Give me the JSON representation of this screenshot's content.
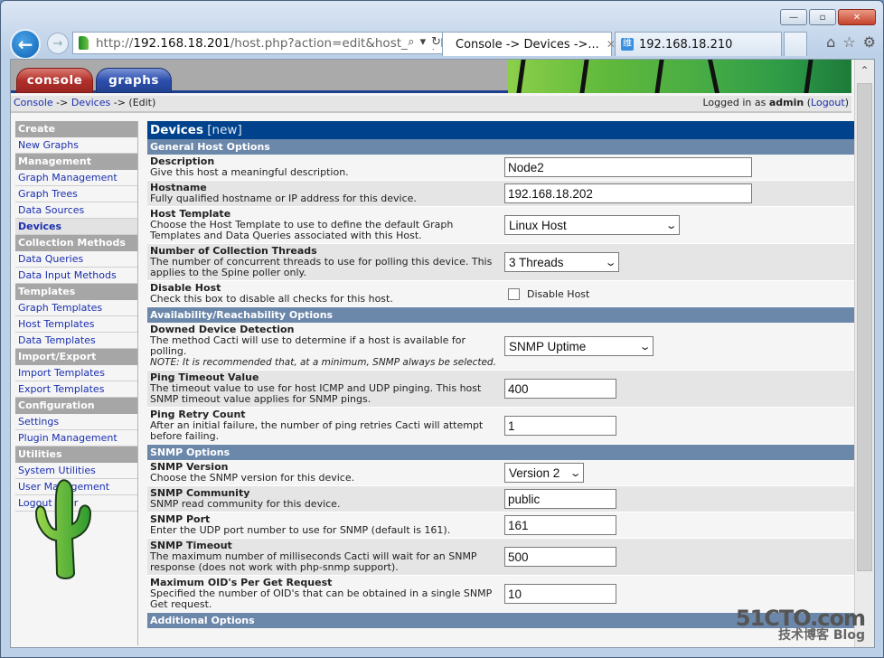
{
  "browser": {
    "address_url_prefix": "http://",
    "address_host": "192.168.18.201",
    "address_path": "/host.php?action=edit&host_templ",
    "tabs": [
      {
        "title": "Console -> Devices ->...",
        "active": true
      },
      {
        "title": "192.168.18.210",
        "active": false
      }
    ],
    "window_controls": {
      "minimize": "—",
      "maximize": "▫",
      "close": "✕"
    }
  },
  "header": {
    "tabs": [
      {
        "label": "console"
      },
      {
        "label": "graphs"
      }
    ]
  },
  "breadcrumb": {
    "items": [
      "Console",
      "Devices",
      "(Edit)"
    ],
    "separator": "->",
    "login_prefix": "Logged in as",
    "user": "admin",
    "logout": "Logout"
  },
  "sidebar": {
    "items": [
      {
        "type": "head",
        "label": "Create"
      },
      {
        "type": "link",
        "label": "New Graphs"
      },
      {
        "type": "head",
        "label": "Management"
      },
      {
        "type": "link",
        "label": "Graph Management"
      },
      {
        "type": "link",
        "label": "Graph Trees"
      },
      {
        "type": "link",
        "label": "Data Sources"
      },
      {
        "type": "active",
        "label": "Devices"
      },
      {
        "type": "head",
        "label": "Collection Methods"
      },
      {
        "type": "link",
        "label": "Data Queries"
      },
      {
        "type": "link",
        "label": "Data Input Methods"
      },
      {
        "type": "head",
        "label": "Templates"
      },
      {
        "type": "link",
        "label": "Graph Templates"
      },
      {
        "type": "link",
        "label": "Host Templates"
      },
      {
        "type": "link",
        "label": "Data Templates"
      },
      {
        "type": "head",
        "label": "Import/Export"
      },
      {
        "type": "link",
        "label": "Import Templates"
      },
      {
        "type": "link",
        "label": "Export Templates"
      },
      {
        "type": "head",
        "label": "Configuration"
      },
      {
        "type": "link",
        "label": "Settings"
      },
      {
        "type": "link",
        "label": "Plugin Management"
      },
      {
        "type": "head",
        "label": "Utilities"
      },
      {
        "type": "link",
        "label": "System Utilities"
      },
      {
        "type": "link",
        "label": "User Management"
      },
      {
        "type": "link",
        "label": "Logout User"
      }
    ]
  },
  "main": {
    "title": "Devices",
    "title_suffix": "[new]",
    "sections": [
      {
        "title": "General Host Options",
        "fields": [
          {
            "label": "Description",
            "desc": "Give this host a meaningful description.",
            "type": "text",
            "value": "Node2"
          },
          {
            "label": "Hostname",
            "desc": "Fully qualified hostname or IP address for this device.",
            "type": "text",
            "value": "192.168.18.202"
          },
          {
            "label": "Host Template",
            "desc": "Choose the Host Template to use to define the default Graph Templates and Data Queries associated with this Host.",
            "type": "select",
            "value": "Linux Host"
          },
          {
            "label": "Number of Collection Threads",
            "desc": "The number of concurrent threads to use for polling this device. This applies to the Spine poller only.",
            "type": "select",
            "value": "3 Threads"
          },
          {
            "label": "Disable Host",
            "desc": "Check this box to disable all checks for this host.",
            "type": "checkbox",
            "value": "Disable Host",
            "checked": false
          }
        ]
      },
      {
        "title": "Availability/Reachability Options",
        "fields": [
          {
            "label": "Downed Device Detection",
            "desc": "The method Cacti will use to determine if a host is available for polling.",
            "note": "NOTE: It is recommended that, at a minimum, SNMP always be selected.",
            "type": "select",
            "value": "SNMP Uptime"
          },
          {
            "label": "Ping Timeout Value",
            "desc": "The timeout value to use for host ICMP and UDP pinging. This host SNMP timeout value applies for SNMP pings.",
            "type": "text",
            "value": "400"
          },
          {
            "label": "Ping Retry Count",
            "desc": "After an initial failure, the number of ping retries Cacti will attempt before failing.",
            "type": "text",
            "value": "1"
          }
        ]
      },
      {
        "title": "SNMP Options",
        "fields": [
          {
            "label": "SNMP Version",
            "desc": "Choose the SNMP version for this device.",
            "type": "select",
            "value": "Version 2"
          },
          {
            "label": "SNMP Community",
            "desc": "SNMP read community for this device.",
            "type": "text",
            "value": "public"
          },
          {
            "label": "SNMP Port",
            "desc": "Enter the UDP port number to use for SNMP (default is 161).",
            "type": "text",
            "value": "161"
          },
          {
            "label": "SNMP Timeout",
            "desc": "The maximum number of milliseconds Cacti will wait for an SNMP response (does not work with php-snmp support).",
            "type": "text",
            "value": "500"
          },
          {
            "label": "Maximum OID's Per Get Request",
            "desc": "Specified the number of OID's that can be obtained in a single SNMP Get request.",
            "type": "text",
            "value": "10"
          }
        ]
      },
      {
        "title": "Additional Options",
        "fields": []
      }
    ]
  },
  "watermark": {
    "line1": "51CTO.com",
    "line2": "技术博客",
    "line3": "Blog"
  }
}
